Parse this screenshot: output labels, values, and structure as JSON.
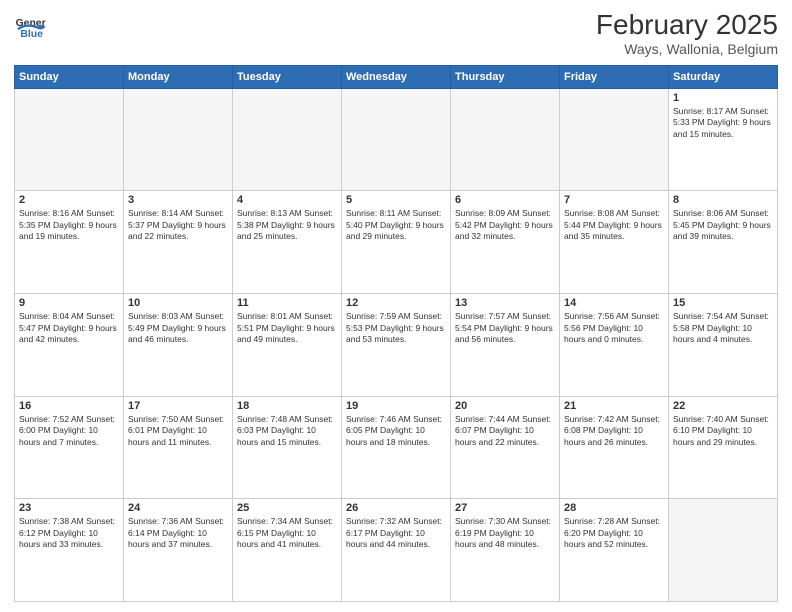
{
  "header": {
    "logo_general": "General",
    "logo_blue": "Blue",
    "title": "February 2025",
    "subtitle": "Ways, Wallonia, Belgium"
  },
  "weekdays": [
    "Sunday",
    "Monday",
    "Tuesday",
    "Wednesday",
    "Thursday",
    "Friday",
    "Saturday"
  ],
  "weeks": [
    [
      {
        "day": "",
        "info": ""
      },
      {
        "day": "",
        "info": ""
      },
      {
        "day": "",
        "info": ""
      },
      {
        "day": "",
        "info": ""
      },
      {
        "day": "",
        "info": ""
      },
      {
        "day": "",
        "info": ""
      },
      {
        "day": "1",
        "info": "Sunrise: 8:17 AM\nSunset: 5:33 PM\nDaylight: 9 hours and 15 minutes."
      }
    ],
    [
      {
        "day": "2",
        "info": "Sunrise: 8:16 AM\nSunset: 5:35 PM\nDaylight: 9 hours and 19 minutes."
      },
      {
        "day": "3",
        "info": "Sunrise: 8:14 AM\nSunset: 5:37 PM\nDaylight: 9 hours and 22 minutes."
      },
      {
        "day": "4",
        "info": "Sunrise: 8:13 AM\nSunset: 5:38 PM\nDaylight: 9 hours and 25 minutes."
      },
      {
        "day": "5",
        "info": "Sunrise: 8:11 AM\nSunset: 5:40 PM\nDaylight: 9 hours and 29 minutes."
      },
      {
        "day": "6",
        "info": "Sunrise: 8:09 AM\nSunset: 5:42 PM\nDaylight: 9 hours and 32 minutes."
      },
      {
        "day": "7",
        "info": "Sunrise: 8:08 AM\nSunset: 5:44 PM\nDaylight: 9 hours and 35 minutes."
      },
      {
        "day": "8",
        "info": "Sunrise: 8:06 AM\nSunset: 5:45 PM\nDaylight: 9 hours and 39 minutes."
      }
    ],
    [
      {
        "day": "9",
        "info": "Sunrise: 8:04 AM\nSunset: 5:47 PM\nDaylight: 9 hours and 42 minutes."
      },
      {
        "day": "10",
        "info": "Sunrise: 8:03 AM\nSunset: 5:49 PM\nDaylight: 9 hours and 46 minutes."
      },
      {
        "day": "11",
        "info": "Sunrise: 8:01 AM\nSunset: 5:51 PM\nDaylight: 9 hours and 49 minutes."
      },
      {
        "day": "12",
        "info": "Sunrise: 7:59 AM\nSunset: 5:53 PM\nDaylight: 9 hours and 53 minutes."
      },
      {
        "day": "13",
        "info": "Sunrise: 7:57 AM\nSunset: 5:54 PM\nDaylight: 9 hours and 56 minutes."
      },
      {
        "day": "14",
        "info": "Sunrise: 7:56 AM\nSunset: 5:56 PM\nDaylight: 10 hours and 0 minutes."
      },
      {
        "day": "15",
        "info": "Sunrise: 7:54 AM\nSunset: 5:58 PM\nDaylight: 10 hours and 4 minutes."
      }
    ],
    [
      {
        "day": "16",
        "info": "Sunrise: 7:52 AM\nSunset: 6:00 PM\nDaylight: 10 hours and 7 minutes."
      },
      {
        "day": "17",
        "info": "Sunrise: 7:50 AM\nSunset: 6:01 PM\nDaylight: 10 hours and 11 minutes."
      },
      {
        "day": "18",
        "info": "Sunrise: 7:48 AM\nSunset: 6:03 PM\nDaylight: 10 hours and 15 minutes."
      },
      {
        "day": "19",
        "info": "Sunrise: 7:46 AM\nSunset: 6:05 PM\nDaylight: 10 hours and 18 minutes."
      },
      {
        "day": "20",
        "info": "Sunrise: 7:44 AM\nSunset: 6:07 PM\nDaylight: 10 hours and 22 minutes."
      },
      {
        "day": "21",
        "info": "Sunrise: 7:42 AM\nSunset: 6:08 PM\nDaylight: 10 hours and 26 minutes."
      },
      {
        "day": "22",
        "info": "Sunrise: 7:40 AM\nSunset: 6:10 PM\nDaylight: 10 hours and 29 minutes."
      }
    ],
    [
      {
        "day": "23",
        "info": "Sunrise: 7:38 AM\nSunset: 6:12 PM\nDaylight: 10 hours and 33 minutes."
      },
      {
        "day": "24",
        "info": "Sunrise: 7:36 AM\nSunset: 6:14 PM\nDaylight: 10 hours and 37 minutes."
      },
      {
        "day": "25",
        "info": "Sunrise: 7:34 AM\nSunset: 6:15 PM\nDaylight: 10 hours and 41 minutes."
      },
      {
        "day": "26",
        "info": "Sunrise: 7:32 AM\nSunset: 6:17 PM\nDaylight: 10 hours and 44 minutes."
      },
      {
        "day": "27",
        "info": "Sunrise: 7:30 AM\nSunset: 6:19 PM\nDaylight: 10 hours and 48 minutes."
      },
      {
        "day": "28",
        "info": "Sunrise: 7:28 AM\nSunset: 6:20 PM\nDaylight: 10 hours and 52 minutes."
      },
      {
        "day": "",
        "info": ""
      }
    ]
  ]
}
